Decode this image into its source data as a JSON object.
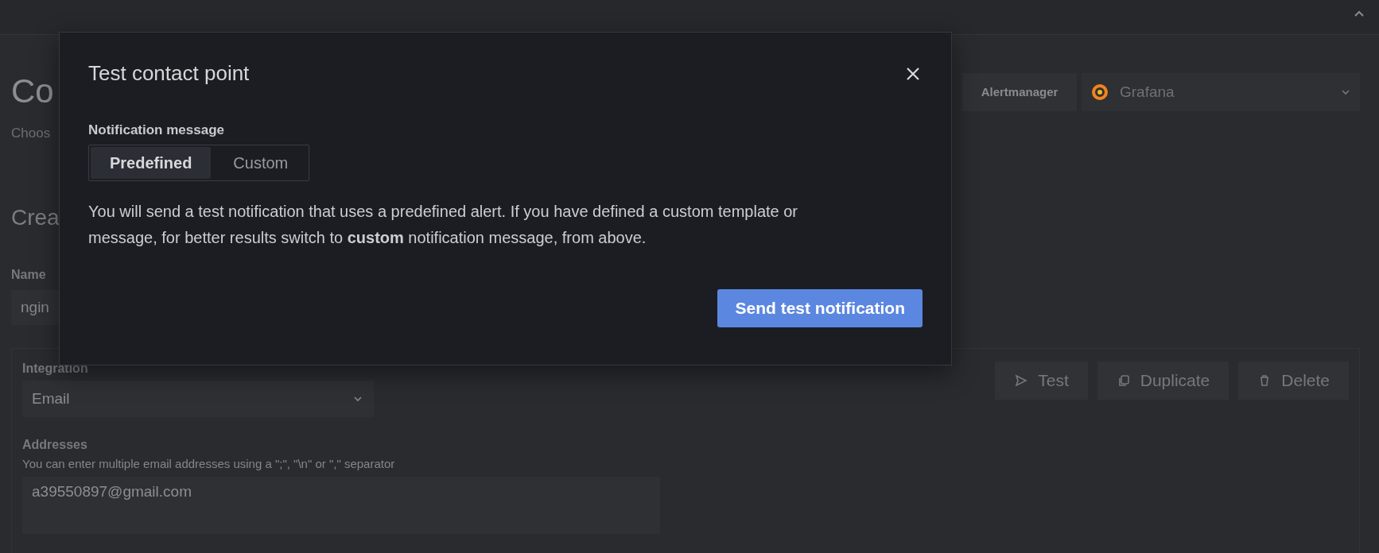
{
  "page": {
    "title": "Co",
    "subtitle": "Choos",
    "section_title": "Crea",
    "alertmanager": {
      "label": "Alertmanager",
      "value": "Grafana"
    },
    "name_field": {
      "label": "Name",
      "value": "ngin"
    },
    "integration": {
      "label": "Integration",
      "value": "Email",
      "addresses": {
        "label": "Addresses",
        "hint": "You can enter multiple email addresses using a \";\", \"\\n\" or \",\" separator",
        "value": "a39550897@gmail.com"
      },
      "actions": [
        {
          "label": "Test",
          "kind": "send"
        },
        {
          "label": "Duplicate",
          "kind": "duplicate"
        },
        {
          "label": "Delete",
          "kind": "delete"
        }
      ]
    }
  },
  "dialog": {
    "title": "Test contact point",
    "field_label": "Notification message",
    "options": [
      {
        "label": "Predefined",
        "selected": true
      },
      {
        "label": "Custom",
        "selected": false
      }
    ],
    "description": "You will send a test notification that uses a predefined alert. If you have defined a custom template or message, for better results switch to **custom** notification message, from above.",
    "buttons": [
      "Send test notification"
    ]
  }
}
